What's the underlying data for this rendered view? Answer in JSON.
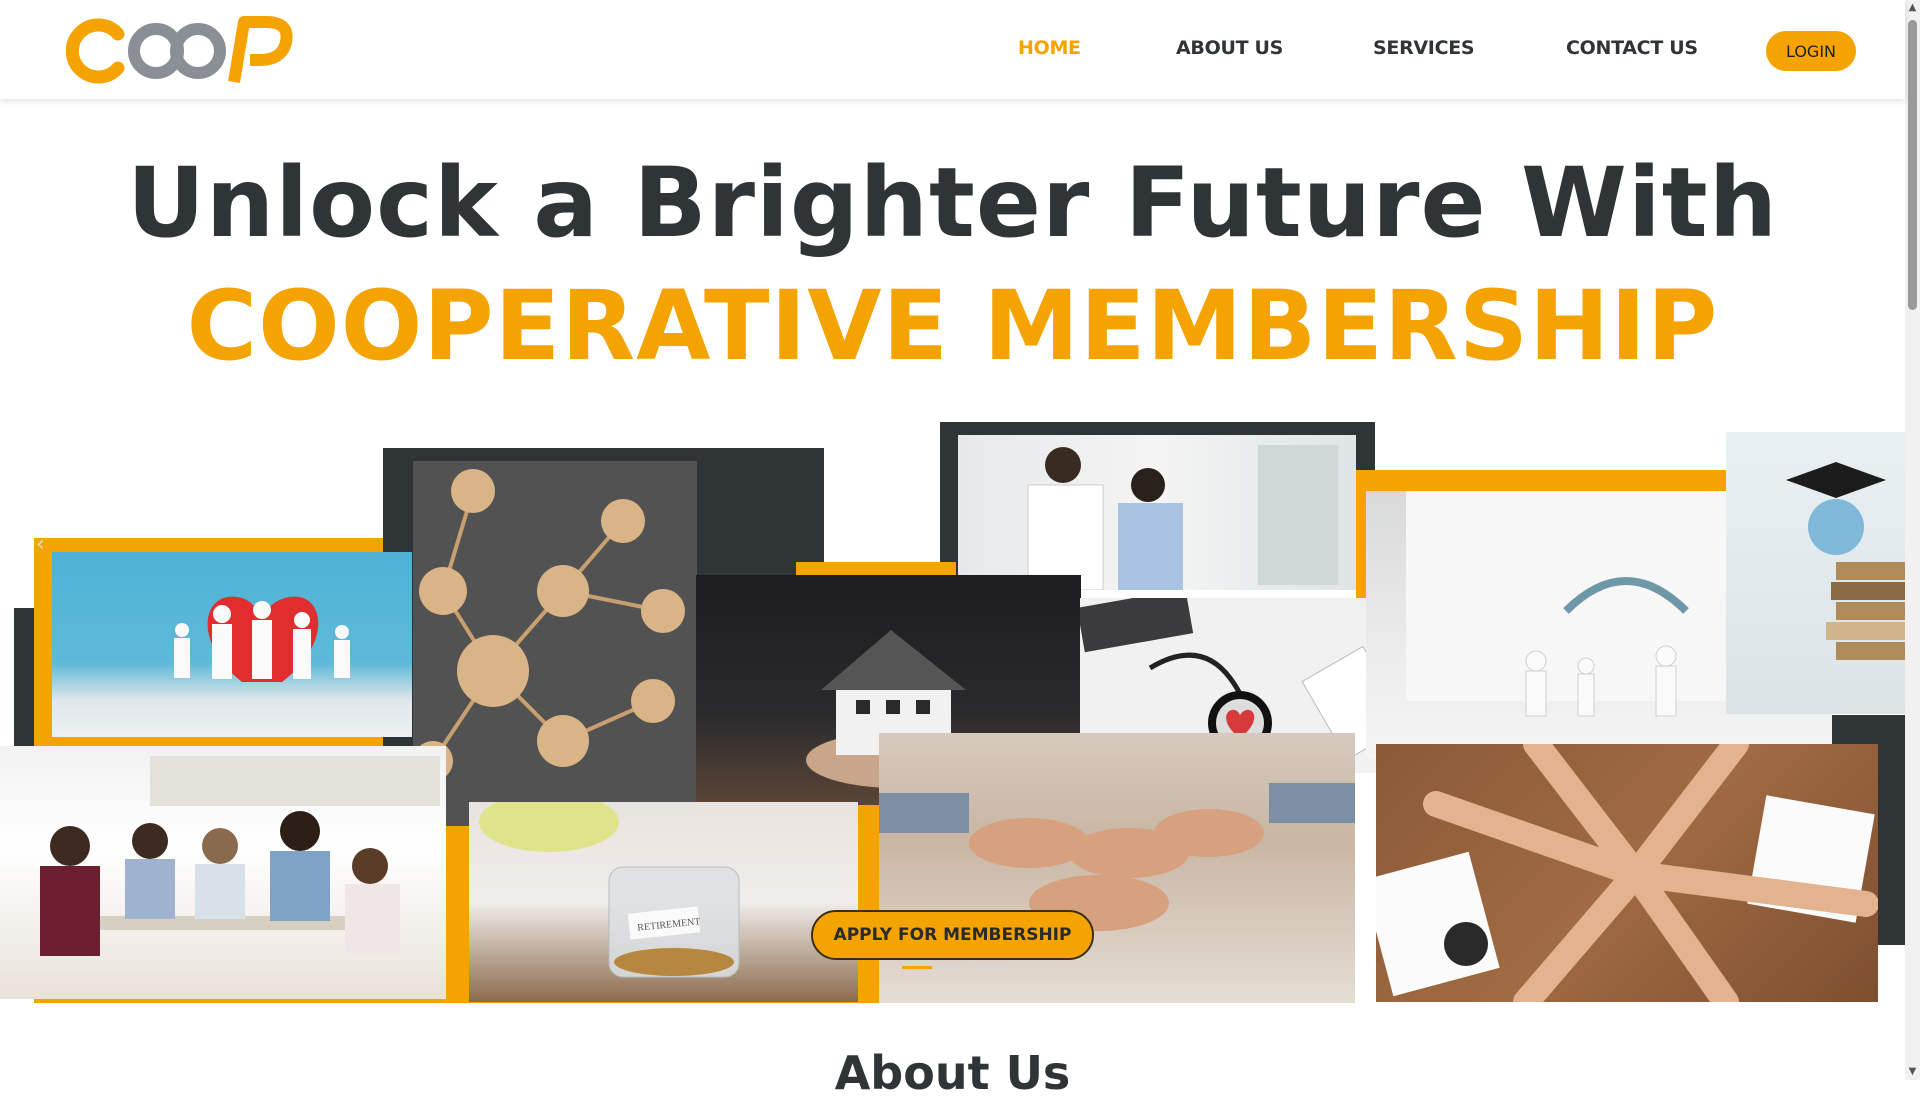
{
  "header": {
    "logo_text": "COOP",
    "nav": [
      {
        "label": "HOME",
        "active": true
      },
      {
        "label": "ABOUT US",
        "active": false
      },
      {
        "label": "SERVICES",
        "active": false
      },
      {
        "label": "CONTACT US",
        "active": false
      }
    ],
    "login_label": "LOGIN"
  },
  "hero": {
    "line1": "Unlock a Brighter Future With",
    "line2": "COOPERATIVE MEMBERSHIP",
    "cta_label": "APPLY FOR MEMBERSHIP",
    "slide_count": 3,
    "active_slide": 1,
    "collage_images": [
      "paper-family-with-heart",
      "wooden-people-network",
      "doctor-with-patient",
      "hands-holding-house",
      "stethoscope-with-heart",
      "doctor-with-paper-family",
      "graduation-cap-with-books",
      "students-studying",
      "retirement-coin-jar",
      "team-fist-bump",
      "team-hands-stack"
    ],
    "retirement_jar_label": "RETIREMENT"
  },
  "next_section": {
    "title": "About Us"
  },
  "colors": {
    "accent": "#f5a300",
    "dark": "#2f3436"
  }
}
